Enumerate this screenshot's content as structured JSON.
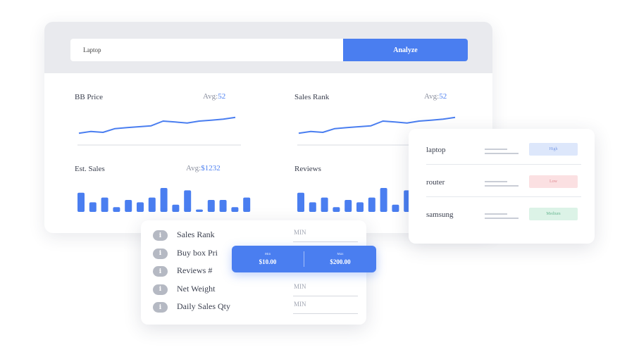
{
  "search": {
    "value": "Laptop",
    "button_label": "Analyze"
  },
  "metrics": [
    {
      "title": "BB Price",
      "avg_label": "Avg:",
      "avg_value": "52"
    },
    {
      "title": "Sales Rank",
      "avg_label": "Avg:",
      "avg_value": "52"
    },
    {
      "title": "Est. Sales",
      "avg_label": "Avg:",
      "avg_value": "$1232"
    },
    {
      "title": "Reviews",
      "avg_label": "",
      "avg_value": ""
    }
  ],
  "chart_data": [
    {
      "type": "line",
      "title": "BB Price",
      "x": [
        1,
        2,
        3,
        4,
        5,
        6,
        7,
        8,
        9,
        10,
        11,
        12,
        13,
        14
      ],
      "values": [
        8,
        10,
        9,
        13,
        14,
        15,
        16,
        21,
        20,
        19,
        21,
        22,
        23,
        25
      ],
      "ylim": [
        0,
        30
      ]
    },
    {
      "type": "line",
      "title": "Sales Rank",
      "x": [
        1,
        2,
        3,
        4,
        5,
        6,
        7,
        8,
        9,
        10,
        11,
        12,
        13,
        14
      ],
      "values": [
        8,
        10,
        9,
        13,
        14,
        15,
        16,
        21,
        20,
        19,
        21,
        22,
        23,
        25
      ],
      "ylim": [
        0,
        30
      ]
    },
    {
      "type": "bar",
      "title": "Est. Sales",
      "values": [
        8,
        4,
        6,
        2,
        5,
        4,
        6,
        10,
        3,
        9,
        1,
        5,
        5,
        2,
        6
      ],
      "ylim": [
        0,
        10
      ]
    },
    {
      "type": "bar",
      "title": "Reviews",
      "values": [
        8,
        4,
        6,
        2,
        5,
        4,
        6,
        10,
        3,
        9
      ],
      "ylim": [
        0,
        10
      ]
    }
  ],
  "keywords": [
    {
      "name": "laptop",
      "level": "High",
      "bg": "#dde7fb",
      "fg": "#7a9be6"
    },
    {
      "name": "router",
      "level": "Low",
      "bg": "#fbe0e2",
      "fg": "#e08a92"
    },
    {
      "name": "samsung",
      "level": "Medium",
      "bg": "#dcf3e7",
      "fg": "#6bb894"
    }
  ],
  "filters": [
    {
      "label": "Sales Rank",
      "placeholder": "MIN"
    },
    {
      "label": "Buy box Pri",
      "placeholder": ""
    },
    {
      "label": "Reviews #",
      "placeholder": ""
    },
    {
      "label": "Net Weight",
      "placeholder": "MIN"
    },
    {
      "label": "Daily Sales Qty",
      "placeholder": "MIN"
    }
  ],
  "price_range": {
    "min_caption": "Min",
    "min_value": "$10.00",
    "max_caption": "Max",
    "max_value": "$200.00"
  },
  "colors": {
    "accent": "#4a7ef0",
    "band": "#e9eaee",
    "icon_grey": "#b5b9c3"
  }
}
